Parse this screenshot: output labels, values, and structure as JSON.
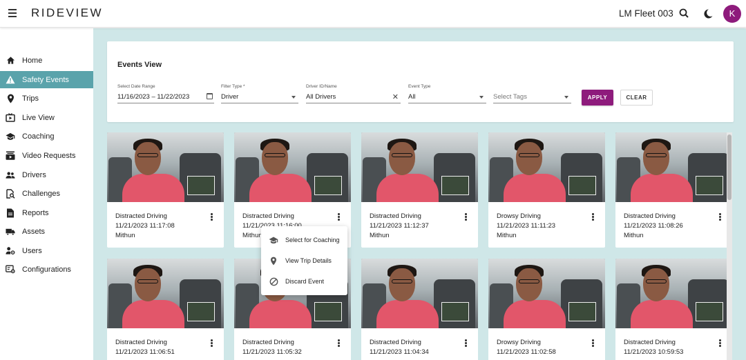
{
  "header": {
    "brand": "RIDEVIEW",
    "fleet_name": "LM Fleet 003",
    "avatar_letter": "K",
    "accent_color": "#8e1b7c"
  },
  "sidebar": {
    "items": [
      {
        "label": "Home",
        "icon": "home-icon"
      },
      {
        "label": "Safety Events",
        "icon": "warning-icon",
        "active": true
      },
      {
        "label": "Trips",
        "icon": "location-pin-icon"
      },
      {
        "label": "Live View",
        "icon": "live-tv-icon"
      },
      {
        "label": "Coaching",
        "icon": "graduation-cap-icon"
      },
      {
        "label": "Video Requests",
        "icon": "video-library-icon"
      },
      {
        "label": "Drivers",
        "icon": "people-icon"
      },
      {
        "label": "Challenges",
        "icon": "challenge-search-icon"
      },
      {
        "label": "Reports",
        "icon": "document-icon"
      },
      {
        "label": "Assets",
        "icon": "truck-icon"
      },
      {
        "label": "Users",
        "icon": "user-gear-icon"
      },
      {
        "label": "Configurations",
        "icon": "settings-list-icon"
      }
    ]
  },
  "filters": {
    "title": "Events View",
    "date_range": {
      "label": "Select Date Range",
      "value": "11/16/2023 – 11/22/2023"
    },
    "filter_type": {
      "label": "Filter Type *",
      "value": "Driver"
    },
    "driver": {
      "label": "Driver ID/Name",
      "value": "All Drivers"
    },
    "event_type": {
      "label": "Event Type",
      "value": "All"
    },
    "tags": {
      "placeholder": "Select Tags"
    },
    "apply_label": "APPLY",
    "clear_label": "CLEAR"
  },
  "events": [
    {
      "type": "Distracted Driving",
      "time": "11/21/2023 11:17:08",
      "driver": "Mithun"
    },
    {
      "type": "Distracted Driving",
      "time": "11/21/2023 11:16:00",
      "driver": "Mithun"
    },
    {
      "type": "Distracted Driving",
      "time": "11/21/2023 11:12:37",
      "driver": "Mithun"
    },
    {
      "type": "Drowsy Driving",
      "time": "11/21/2023 11:11:23",
      "driver": "Mithun"
    },
    {
      "type": "Distracted Driving",
      "time": "11/21/2023 11:08:26",
      "driver": "Mithun"
    },
    {
      "type": "Distracted Driving",
      "time": "11/21/2023 11:06:51",
      "driver": ""
    },
    {
      "type": "Distracted Driving",
      "time": "11/21/2023 11:05:32",
      "driver": ""
    },
    {
      "type": "Distracted Driving",
      "time": "11/21/2023 11:04:34",
      "driver": ""
    },
    {
      "type": "Drowsy Driving",
      "time": "11/21/2023 11:02:58",
      "driver": ""
    },
    {
      "type": "Distracted Driving",
      "time": "11/21/2023 10:59:53",
      "driver": ""
    }
  ],
  "context_menu": {
    "items": [
      {
        "label": "Select for Coaching",
        "icon": "graduation-cap-icon"
      },
      {
        "label": "View Trip Details",
        "icon": "location-pin-icon"
      },
      {
        "label": "Discard Event",
        "icon": "block-icon"
      }
    ]
  }
}
